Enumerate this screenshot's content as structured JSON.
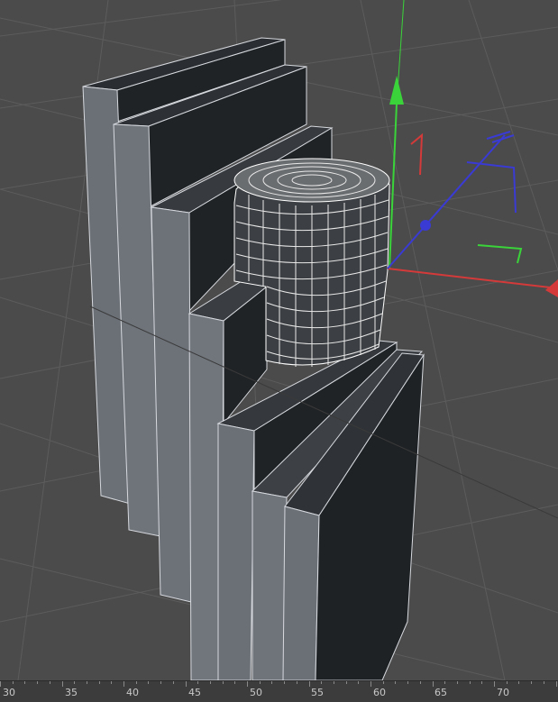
{
  "viewport": {
    "background_color": "#4b4b4b",
    "grid_color": "#5a5a5a",
    "object_face_light": "#6d7279",
    "object_face_dark": "#202326",
    "object_edge": "#d6d9de",
    "axis_colors": {
      "x": "#d43a3a",
      "y": "#3ad43a",
      "z": "#3a3ad4"
    },
    "gizmo_icons": [
      "move-y-arrow-icon",
      "rotate-x-handle-icon",
      "rotate-z-handle-icon",
      "rotate-y-handle-icon",
      "scale-z-handle-icon",
      "z-axis-center-dot-icon"
    ]
  },
  "timeline": {
    "labels": [
      "30",
      "35",
      "40",
      "45",
      "50",
      "55",
      "60",
      "65",
      "70"
    ]
  }
}
